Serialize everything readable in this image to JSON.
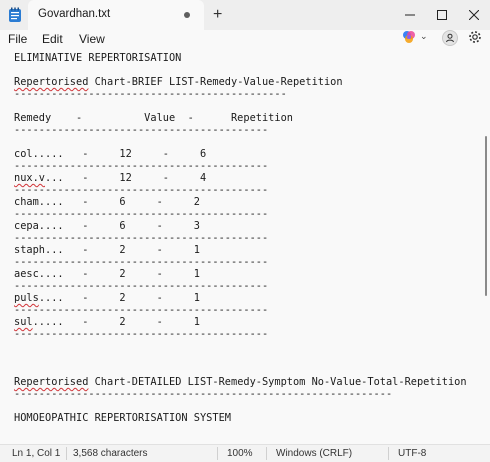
{
  "window": {
    "tab_title": "Govardhan.txt",
    "new_tab_glyph": "+",
    "minimize_icon": "minimize-icon",
    "maximize_icon": "maximize-icon",
    "close_icon": "close-icon"
  },
  "menu": {
    "items": [
      "File",
      "Edit",
      "View"
    ],
    "copilot_chevron": "⌄"
  },
  "editor": {
    "lines": [
      {
        "text": "ELIMINATIVE REPERTORISATION"
      },
      {
        "text": ""
      },
      {
        "squig": "Repertorised",
        "rest": " Chart-BRIEF LIST-Remedy-Value-Repetition"
      },
      {
        "text": "--------------------------------------------"
      },
      {
        "text": ""
      },
      {
        "text": "Remedy    -          Value  -      Repetition"
      },
      {
        "text": "-----------------------------------------"
      },
      {
        "text": ""
      },
      {
        "text": "col.....   -     12     -     6"
      },
      {
        "text": "-----------------------------------------"
      },
      {
        "squig": "nux.v",
        "rest": "...   -     12     -     4"
      },
      {
        "text": "-----------------------------------------"
      },
      {
        "text": "cham....   -     6     -     2"
      },
      {
        "text": "-----------------------------------------"
      },
      {
        "text": "cepa....   -     6     -     3"
      },
      {
        "text": "-----------------------------------------"
      },
      {
        "text": "staph...   -     2     -     1"
      },
      {
        "text": "-----------------------------------------"
      },
      {
        "text": "aesc....   -     2     -     1"
      },
      {
        "text": "-----------------------------------------"
      },
      {
        "squig": "puls",
        "rest": "....   -     2     -     1"
      },
      {
        "text": "-----------------------------------------"
      },
      {
        "squig": "sul",
        "rest": ".....   -     2     -     1"
      },
      {
        "text": "-----------------------------------------"
      },
      {
        "text": ""
      },
      {
        "text": ""
      },
      {
        "text": ""
      },
      {
        "squig": "Repertorised",
        "rest": " Chart-DETAILED LIST-Remedy-Symptom No-Value-Total-Repetition"
      },
      {
        "text": "-------------------------------------------------------------"
      },
      {
        "text": ""
      },
      {
        "text": "HOMOEOPATHIC REPERTORISATION SYSTEM"
      }
    ]
  },
  "status": {
    "position": "Ln 1, Col 1",
    "characters": "3,568 characters",
    "zoom": "100%",
    "line_ending": "Windows (CRLF)",
    "encoding": "UTF-8"
  }
}
